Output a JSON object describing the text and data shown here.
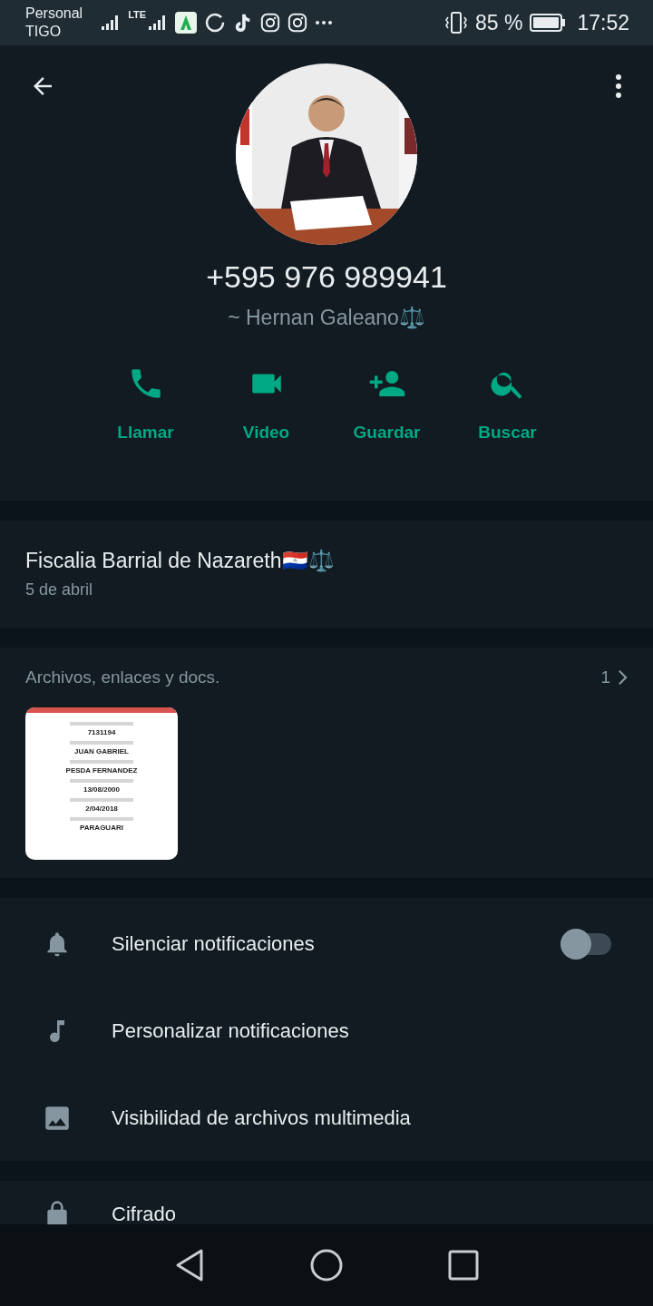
{
  "status_bar": {
    "carrier": [
      "Personal",
      "TIGO"
    ],
    "network": "LTE",
    "battery": "85 %",
    "time": "17:52"
  },
  "profile": {
    "phone": "+595 976 989941",
    "name": "~ Hernan Galeano⚖️"
  },
  "actions": [
    {
      "kind": "call",
      "label": "Llamar"
    },
    {
      "kind": "video",
      "label": "Video"
    },
    {
      "kind": "add_contact",
      "label": "Guardar"
    },
    {
      "kind": "search",
      "label": "Buscar"
    }
  ],
  "about": {
    "text": "Fiscalia Barrial de Nazareth🇵🇾⚖️",
    "date": "5 de abril"
  },
  "media": {
    "title": "Archivos, enlaces y docs.",
    "count": "1",
    "document": [
      "7131194",
      "JUAN GABRIEL",
      "PESDA FERNANDEZ",
      "13/08/2000",
      "2/04/2018",
      "PARAGUARI"
    ]
  },
  "settings": [
    {
      "kind": "mute",
      "label": "Silenciar notificaciones",
      "on": false
    },
    {
      "kind": "tone",
      "label": "Personalizar notificaciones"
    },
    {
      "kind": "visibility",
      "label": "Visibilidad de archivos multimedia"
    }
  ],
  "encryption": {
    "label": "Cifrado"
  }
}
